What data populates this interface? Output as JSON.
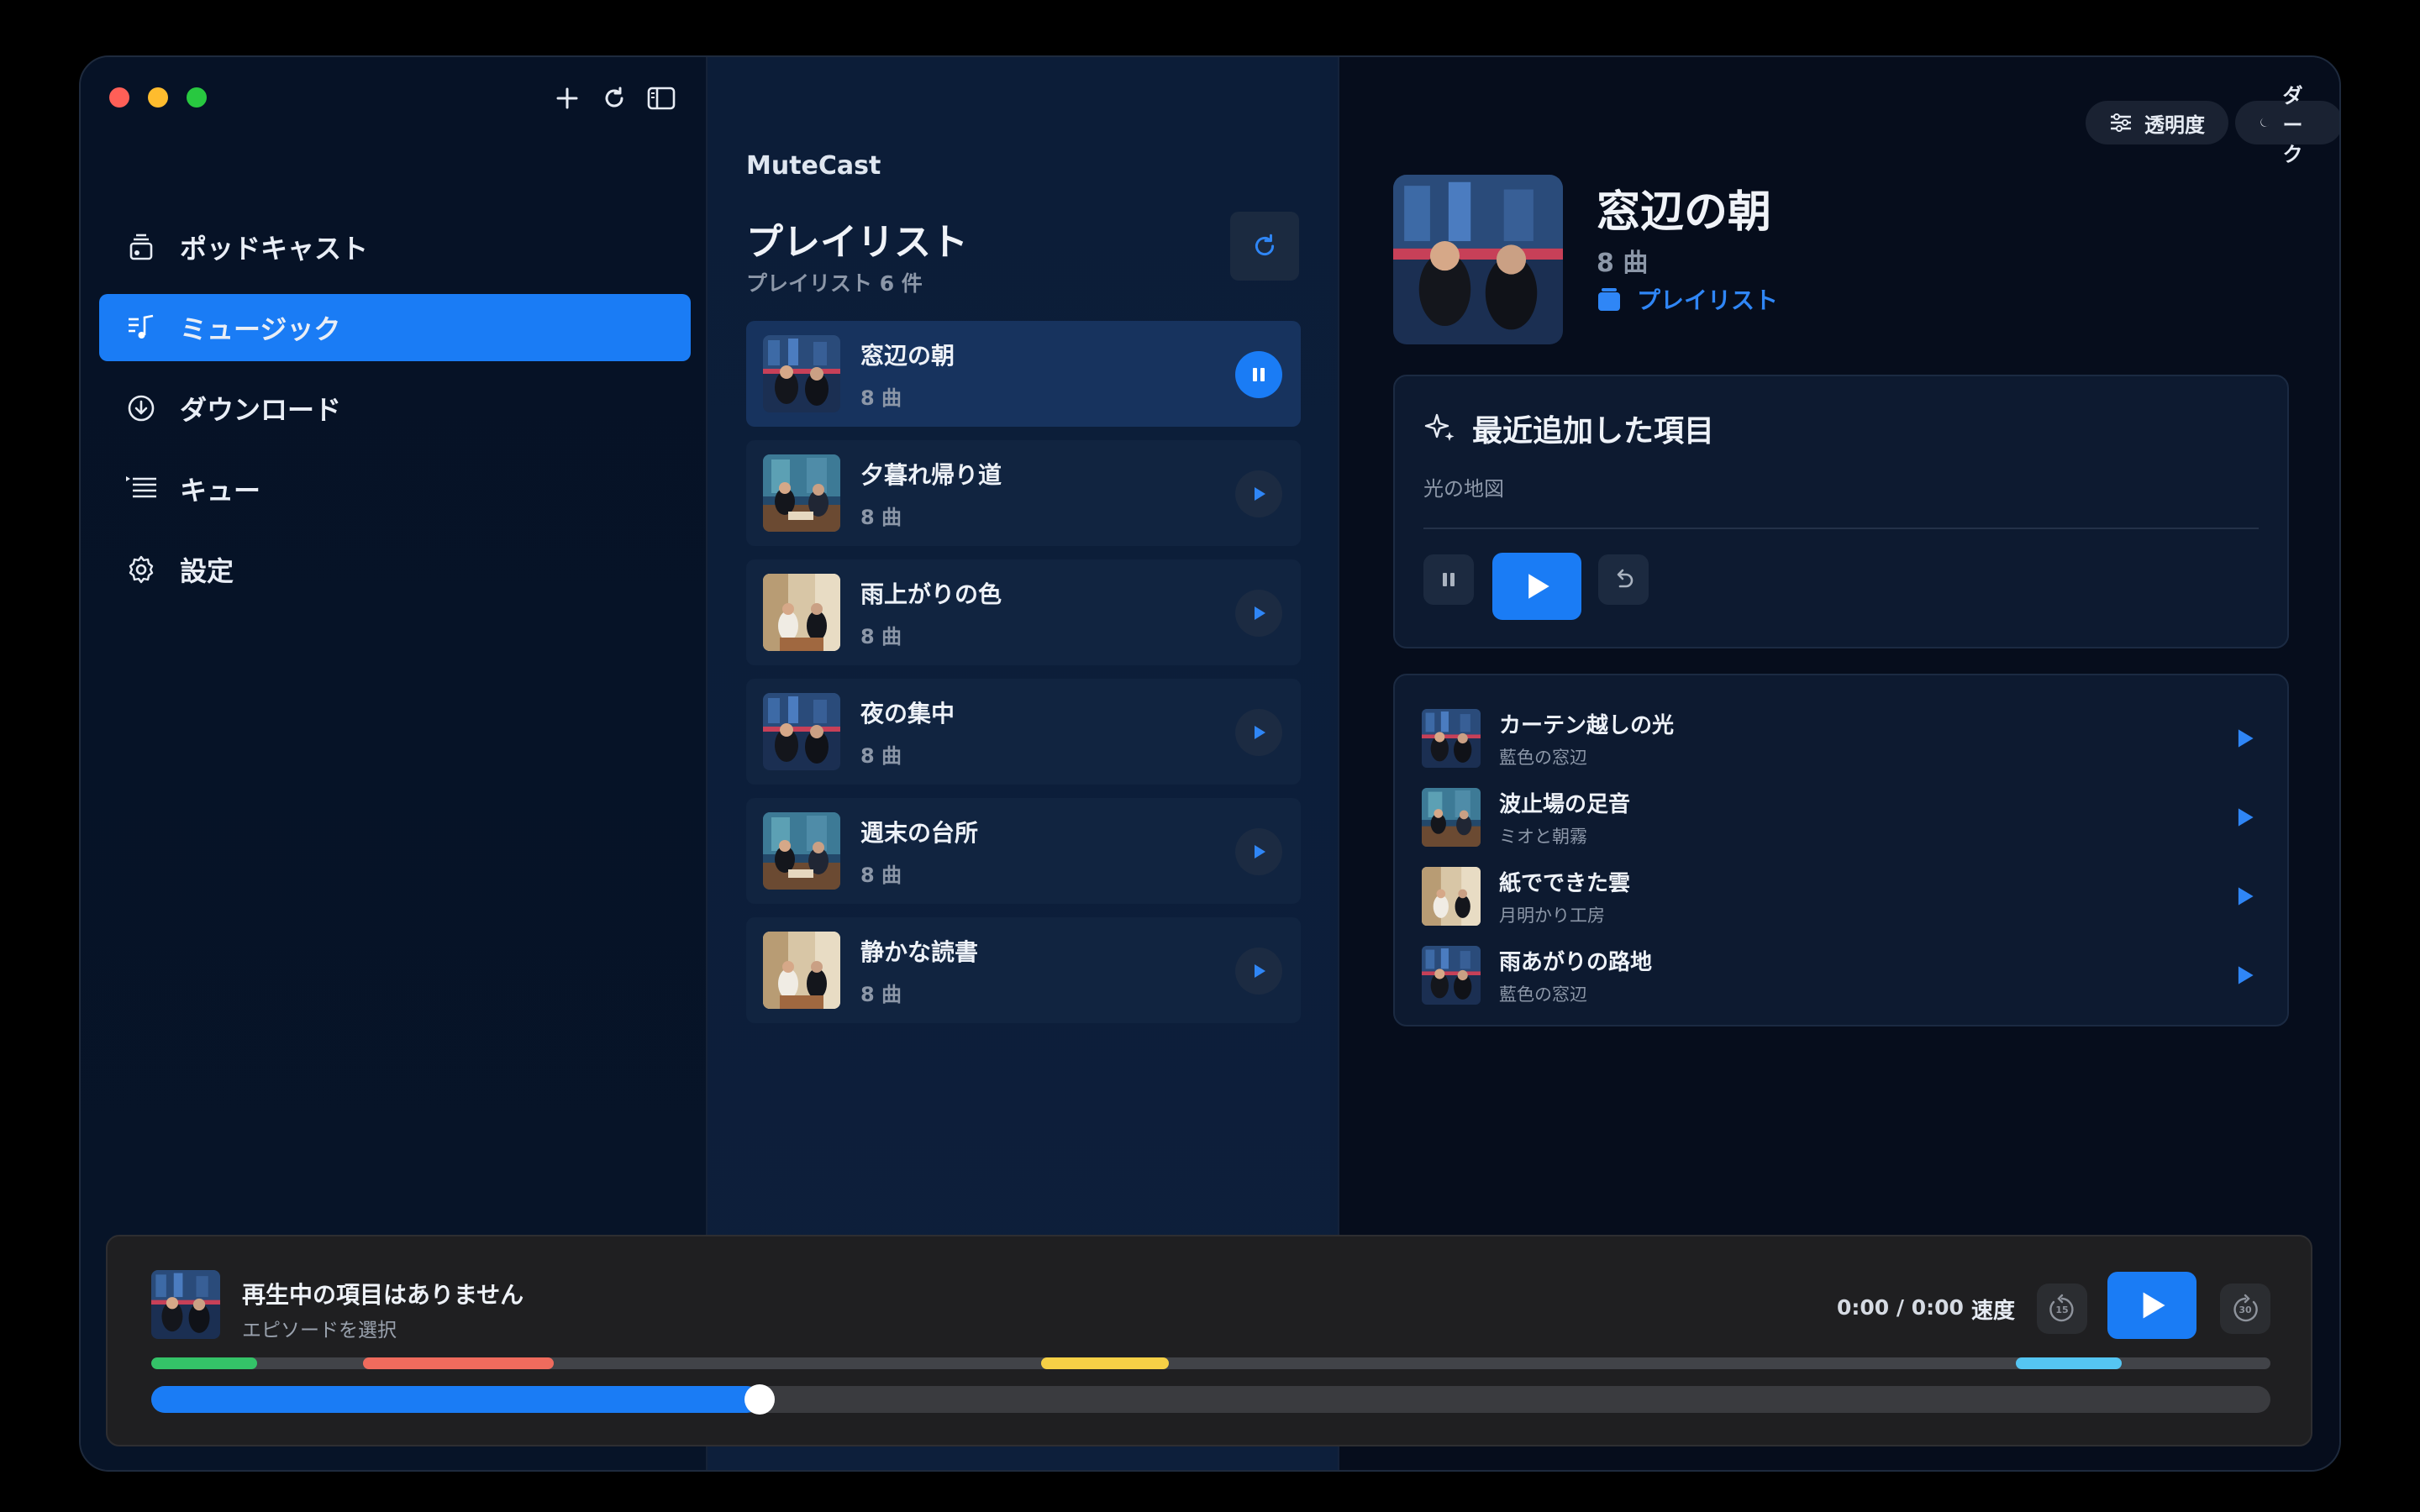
{
  "window": {
    "buttons": [
      "close",
      "minimize",
      "maximize"
    ]
  },
  "sidebar": {
    "tools": [
      {
        "icon": "plus-icon"
      },
      {
        "icon": "refresh-icon"
      },
      {
        "icon": "sidebar-toggle-icon"
      }
    ],
    "items": [
      {
        "label": "ポッドキャスト",
        "icon": "podcast-icon",
        "active": false
      },
      {
        "label": "ミュージック",
        "icon": "music-icon",
        "active": true
      },
      {
        "label": "ダウンロード",
        "icon": "download-icon",
        "active": false
      },
      {
        "label": "キュー",
        "icon": "queue-icon",
        "active": false
      },
      {
        "label": "設定",
        "icon": "gear-icon",
        "active": false
      }
    ]
  },
  "middle": {
    "brand": "MuteCast",
    "title": "プレイリスト",
    "count": "プレイリスト 6 件",
    "playlists": [
      {
        "name": "窓辺の朝",
        "sub": "8 曲",
        "active": true
      },
      {
        "name": "夕暮れ帰り道",
        "sub": "8 曲",
        "active": false
      },
      {
        "name": "雨上がりの色",
        "sub": "8 曲",
        "active": false
      },
      {
        "name": "夜の集中",
        "sub": "8 曲",
        "active": false
      },
      {
        "name": "週末の台所",
        "sub": "8 曲",
        "active": false
      },
      {
        "name": "静かな読書",
        "sub": "8 曲",
        "active": false
      }
    ]
  },
  "right": {
    "opacity_label": "透明度",
    "theme_label": "ダーク",
    "album": {
      "title": "窓辺の朝",
      "sub": "8 曲",
      "link": "プレイリスト"
    },
    "recent": {
      "title": "最近追加した項目",
      "item": "光の地図"
    },
    "tracks": [
      {
        "name": "カーテン越しの光",
        "artist": "藍色の窓辺"
      },
      {
        "name": "波止場の足音",
        "artist": "ミオと朝霧"
      },
      {
        "name": "紙でできた雲",
        "artist": "月明かり工房"
      },
      {
        "name": "雨あがりの路地",
        "artist": "藍色の窓辺"
      }
    ]
  },
  "player": {
    "title": "再生中の項目はありません",
    "subtitle": "エピソードを選択",
    "time": "0:00 / 0:00",
    "speed": "速度",
    "skip_back": "15",
    "skip_forward": "30",
    "progress": 0.28,
    "segments": [
      {
        "color": "#34c368",
        "start": 0.0,
        "end": 0.05
      },
      {
        "color": "#ef6b5d",
        "start": 0.1,
        "end": 0.19
      },
      {
        "color": "#f6d046",
        "start": 0.42,
        "end": 0.48
      },
      {
        "color": "#55c5f2",
        "start": 0.88,
        "end": 0.93
      }
    ]
  },
  "colors": {
    "accent": "#1a7cf5",
    "background": "#071224"
  }
}
